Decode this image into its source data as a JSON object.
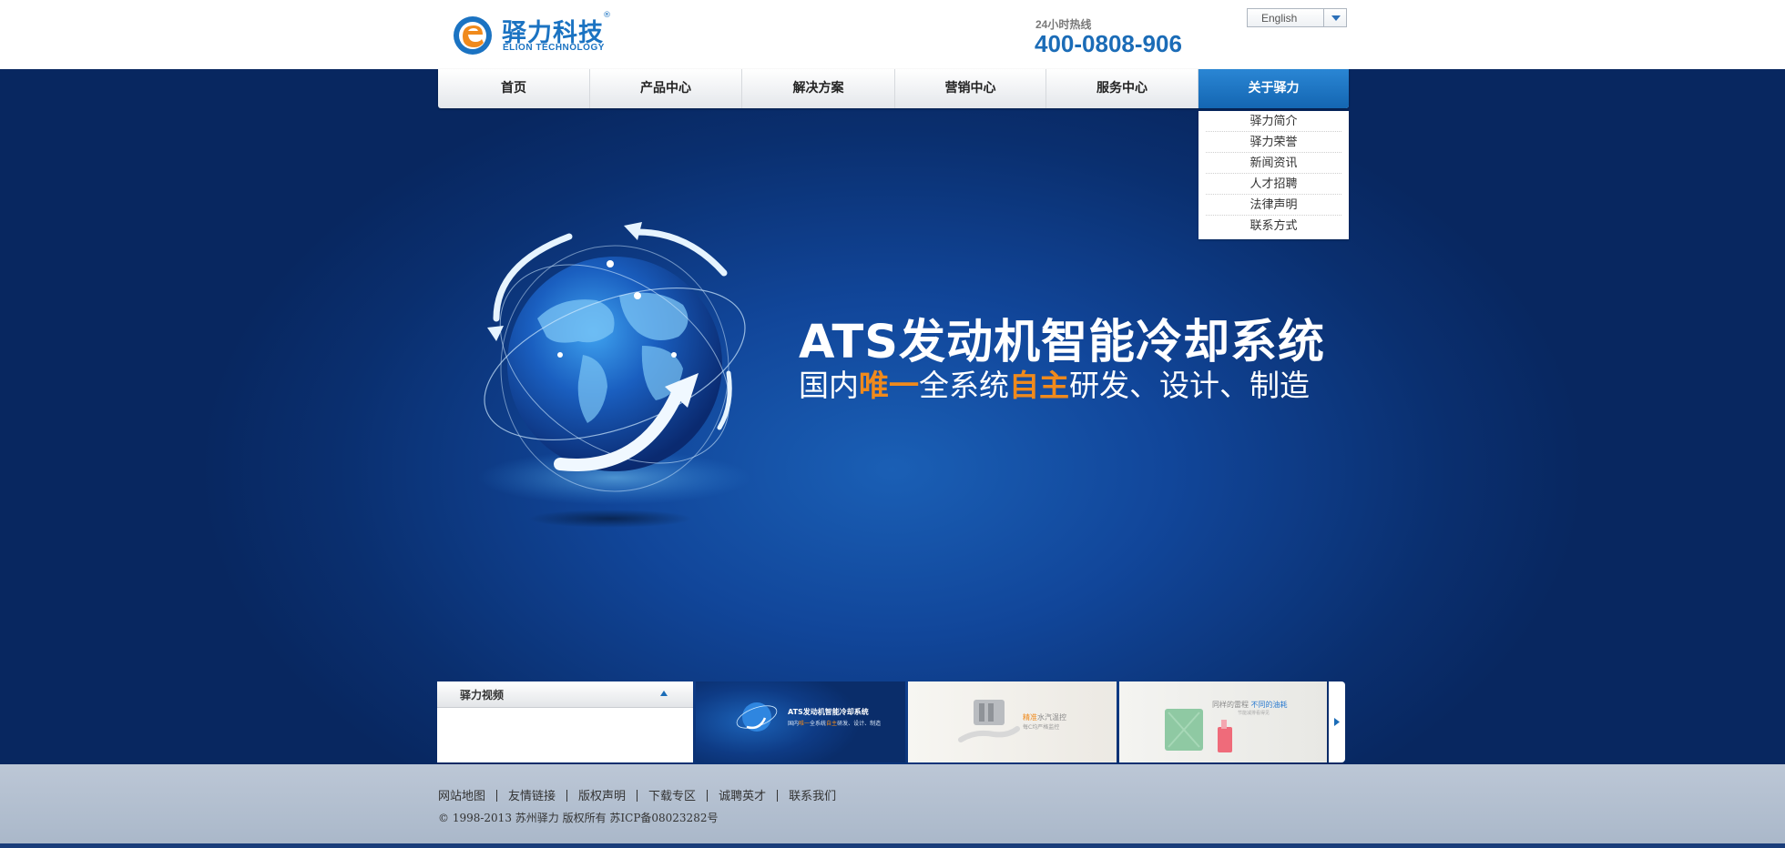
{
  "header": {
    "logo_cn": "驿力科技",
    "logo_en": "ELION TECHNOLOGY",
    "logo_reg": "®",
    "hotline_label": "24小时热线",
    "hotline_number": "400-0808-906",
    "language": "English"
  },
  "nav": {
    "items": [
      {
        "label": "首页"
      },
      {
        "label": "产品中心"
      },
      {
        "label": "解决方案"
      },
      {
        "label": "营销中心"
      },
      {
        "label": "服务中心"
      },
      {
        "label": "关于驿力"
      }
    ],
    "active_index": 5,
    "dropdown": [
      "驿力简介",
      "驿力荣誉",
      "新闻资讯",
      "人才招聘",
      "法律声明",
      "联系方式"
    ]
  },
  "hero": {
    "headline": "ATS发动机智能冷却系统",
    "sub_parts": [
      "国内",
      "唯一",
      "全系统",
      "自主",
      "研发、设计、制造"
    ]
  },
  "video": {
    "title": "驿力视频"
  },
  "thumbnails": {
    "t1_title": "ATS发动机智能冷却系统",
    "t1_sub_parts": [
      "国内",
      "唯一",
      "全系统",
      "自主",
      "研发、设计、制造"
    ],
    "t2_line1_parts": [
      "精准",
      "水汽温控"
    ],
    "t2_line2": "每C均严格监控",
    "t3_line1_parts": [
      "同样的雷程 ",
      "不同的油耗"
    ],
    "t3_line2": "节能减排看得见"
  },
  "footer": {
    "links": [
      "网站地图",
      "友情链接",
      "版权声明",
      "下载专区",
      "诚聘英才",
      "联系我们"
    ],
    "copyright": "© 1998-2013 苏州驿力 版权所有 苏ICP备08023282号"
  },
  "colors": {
    "brand_blue": "#1b6cb7",
    "accent_orange": "#f08a1c",
    "hero_bg": "#0b2f6b",
    "footer_bg": "#b3c0d0"
  }
}
